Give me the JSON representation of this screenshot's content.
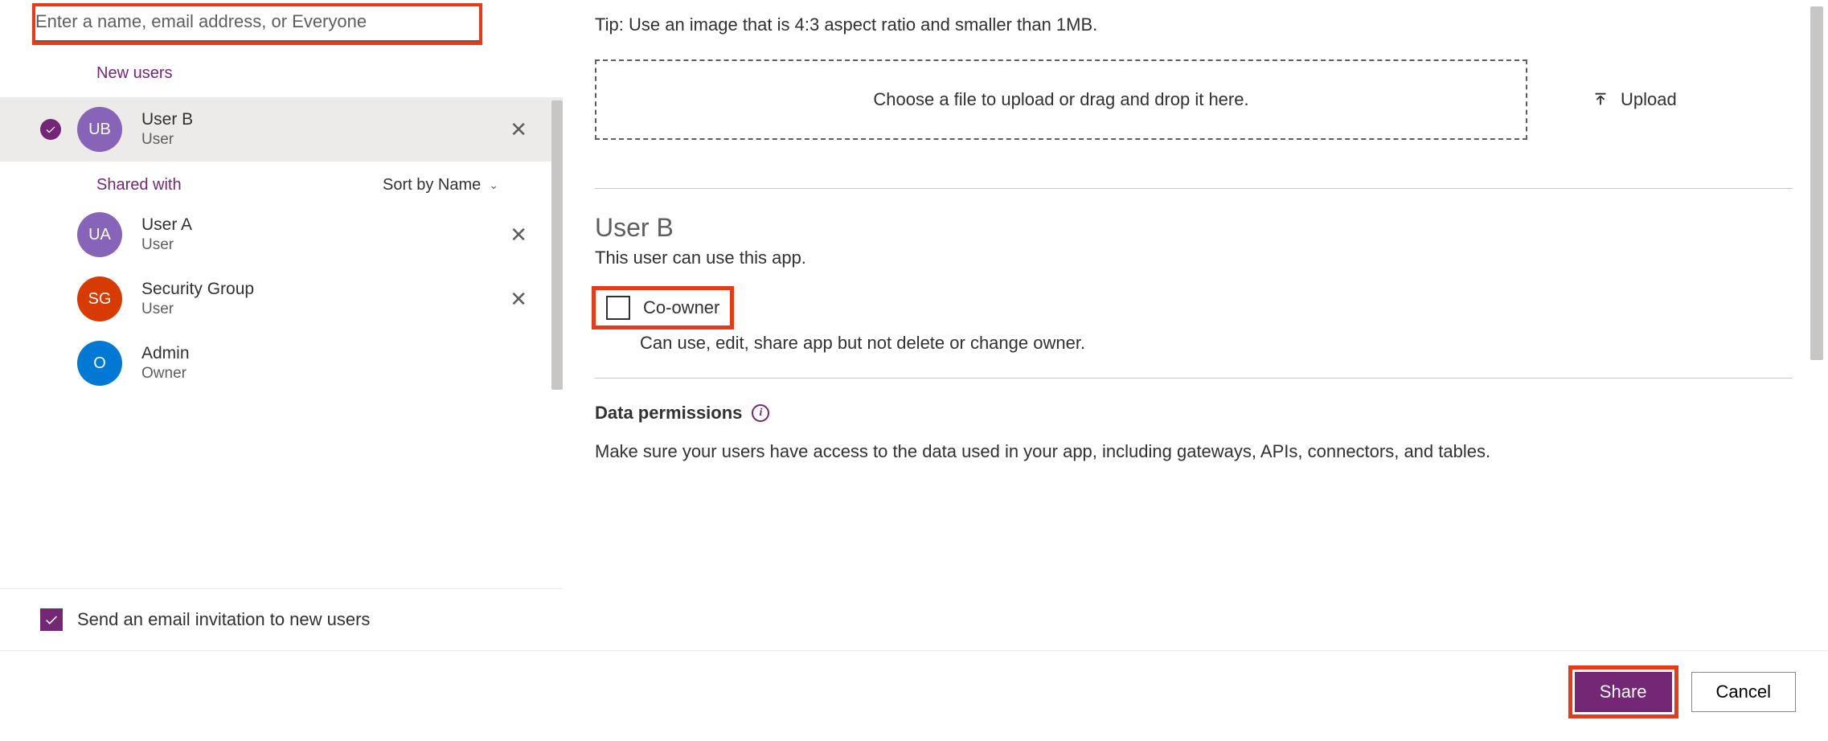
{
  "colors": {
    "accent": "#742774",
    "highlight": "#e83a17"
  },
  "search": {
    "placeholder": "Enter a name, email address, or Everyone"
  },
  "sections": {
    "new_users": "New users",
    "shared_with": "Shared with"
  },
  "sort": {
    "label": "Sort by Name"
  },
  "new_users": [
    {
      "initials": "UB",
      "name": "User B",
      "role": "User",
      "avatar_class": "av-purple",
      "selected": true,
      "removable": true
    }
  ],
  "shared_users": [
    {
      "initials": "UA",
      "name": "User A",
      "role": "User",
      "avatar_class": "av-purple2",
      "removable": true
    },
    {
      "initials": "SG",
      "name": "Security Group",
      "role": "User",
      "avatar_class": "av-red",
      "removable": true
    },
    {
      "initials": "O",
      "name": "Admin",
      "role": "Owner",
      "avatar_class": "av-blue",
      "removable": false
    }
  ],
  "email_invite": {
    "checked": true,
    "label": "Send an email invitation to new users"
  },
  "right": {
    "tip": "Tip: Use an image that is 4:3 aspect ratio and smaller than 1MB.",
    "dropzone": "Choose a file to upload or drag and drop it here.",
    "upload_label": "Upload",
    "selected_user": "User B",
    "selected_user_desc": "This user can use this app.",
    "coowner": {
      "label": "Co-owner",
      "desc": "Can use, edit, share app but not delete or change owner."
    },
    "data_permissions": {
      "title": "Data permissions",
      "text": "Make sure your users have access to the data used in your app, including gateways, APIs, connectors, and tables."
    }
  },
  "footer": {
    "share": "Share",
    "cancel": "Cancel"
  }
}
